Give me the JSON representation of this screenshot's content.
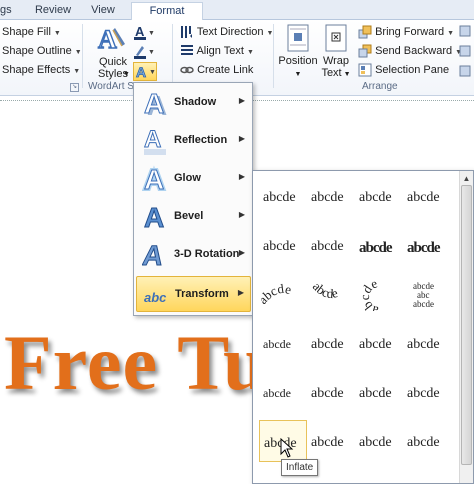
{
  "tabs": [
    {
      "label": "gs"
    },
    {
      "label": "Review"
    },
    {
      "label": "View"
    },
    {
      "label": "Format"
    }
  ],
  "ribbon": {
    "shape_fill": "Shape Fill",
    "shape_outline": "Shape Outline",
    "shape_effects": "Shape Effects",
    "quick_styles_line1": "Quick",
    "quick_styles_line2": "Styles",
    "wordart_group": "WordArt S",
    "text_direction": "Text Direction",
    "align_text": "Align Text",
    "create_link": "Create Link",
    "position": "Position",
    "wrap_line1": "Wrap",
    "wrap_line2": "Text",
    "bring_forward": "Bring Forward",
    "send_backward": "Send Backward",
    "selection_pane": "Selection Pane",
    "arrange_group": "Arrange"
  },
  "text_effects_menu": [
    {
      "label": "Shadow",
      "icon": "shadow-effect-icon"
    },
    {
      "label": "Reflection",
      "icon": "reflection-effect-icon"
    },
    {
      "label": "Glow",
      "icon": "glow-effect-icon"
    },
    {
      "label": "Bevel",
      "icon": "bevel-effect-icon"
    },
    {
      "label": "3-D Rotation",
      "icon": "3d-rotation-effect-icon"
    },
    {
      "label": "Transform",
      "icon": "transform-effect-icon"
    }
  ],
  "gallery_sample_text": "abcde",
  "gallery_sample_small": "abc",
  "tooltip": "Inflate",
  "document_text": "Free Tut",
  "colors": {
    "wordart_orange": "#e26f1b",
    "hover_gold": "#ffd65c",
    "ribbon_blue": "#e6ecf5"
  }
}
